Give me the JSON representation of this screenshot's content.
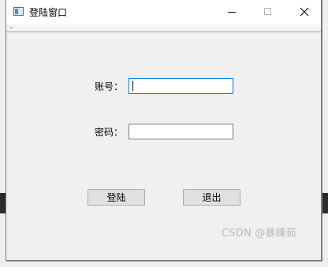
{
  "window": {
    "title": "登陆窗口",
    "icons": {
      "app": "window-app-icon",
      "minimize": "minimize-icon",
      "maximize": "maximize-icon",
      "close": "close-icon"
    }
  },
  "form": {
    "account_label": "账号：",
    "account_value": "",
    "password_label": "密码：",
    "password_value": ""
  },
  "buttons": {
    "login_label": "登陆",
    "exit_label": "退出"
  },
  "watermark": {
    "text": "CSDN @暴躁茹"
  },
  "colors": {
    "focus_border": "#0078d7",
    "window_bg": "#f0f0f0"
  }
}
